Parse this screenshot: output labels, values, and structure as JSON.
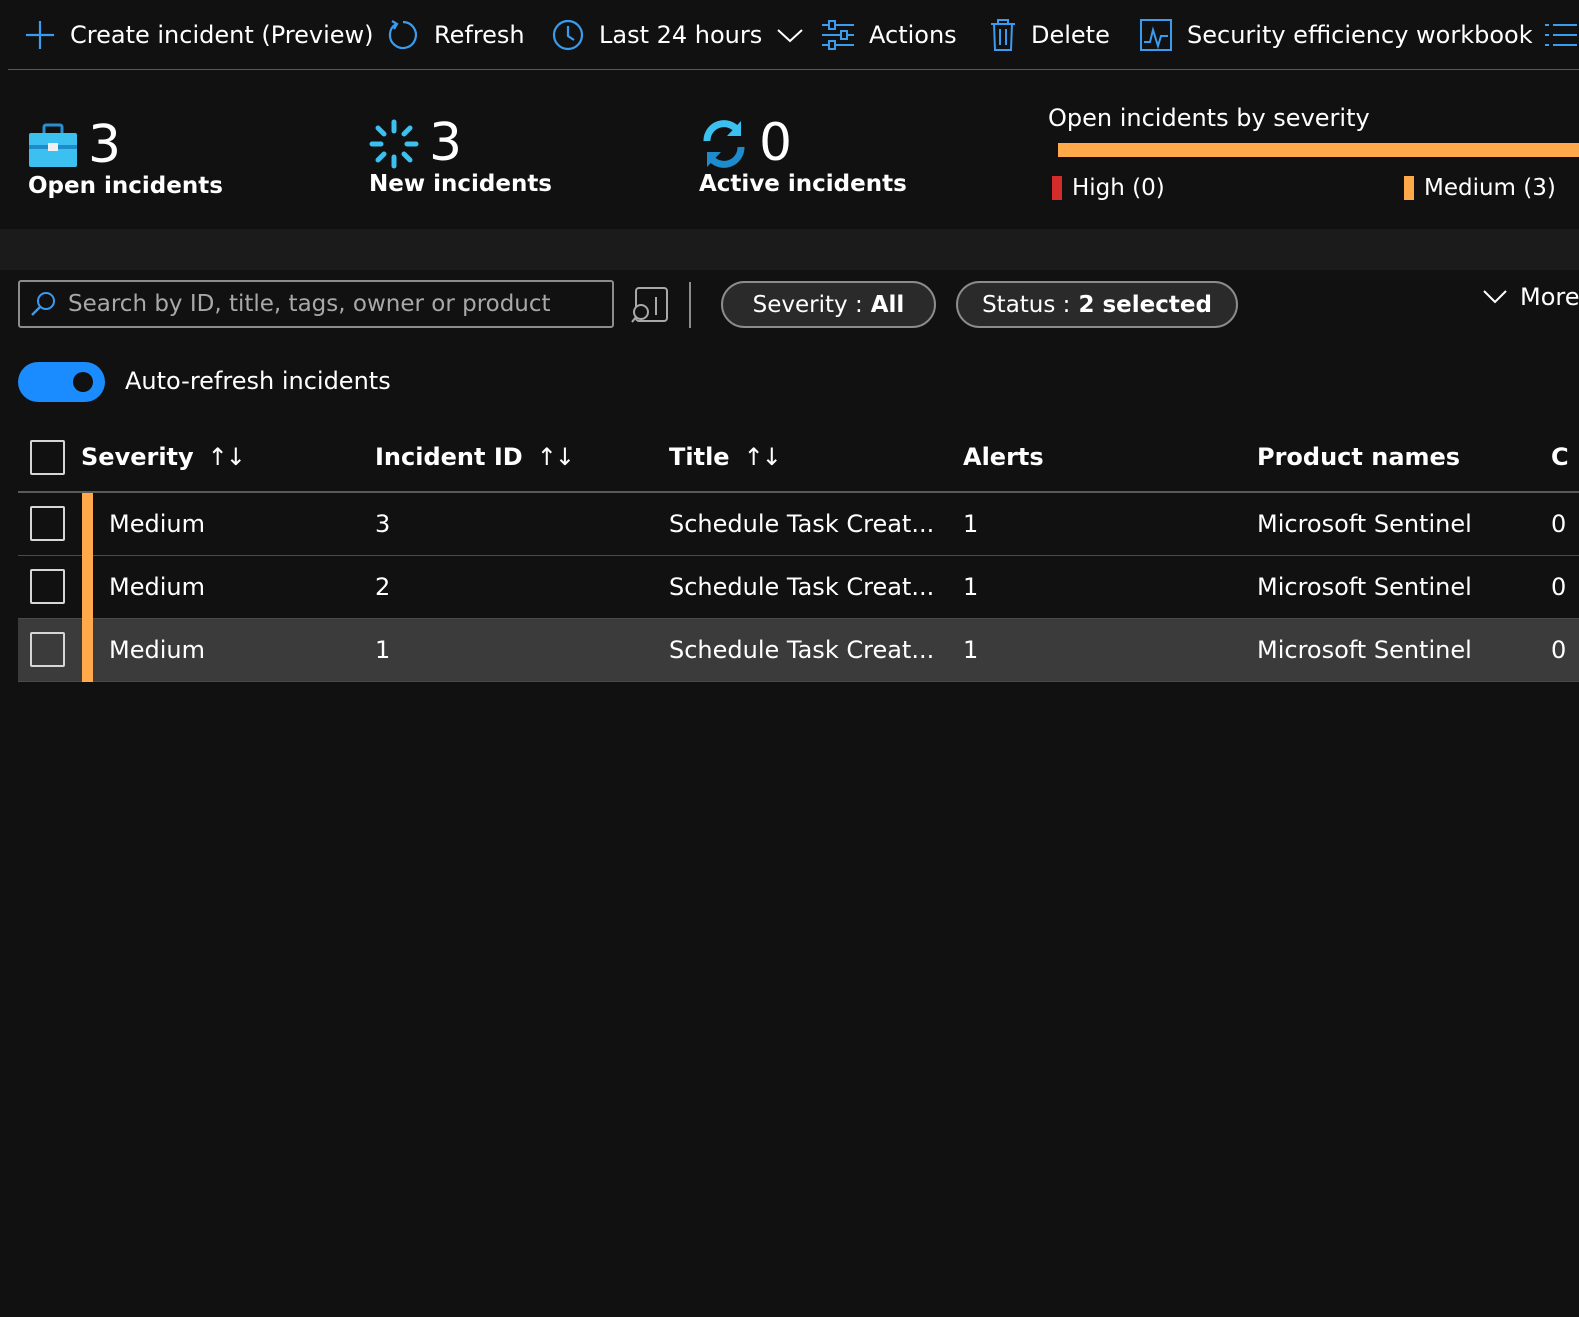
{
  "toolbar": {
    "create_label": "Create incident (Preview)",
    "refresh_label": "Refresh",
    "timerange_label": "Last 24 hours",
    "actions_label": "Actions",
    "delete_label": "Delete",
    "workbook_label": "Security efficiency workbook"
  },
  "summary": {
    "open": {
      "count": "3",
      "label": "Open incidents"
    },
    "new": {
      "count": "3",
      "label": "New incidents"
    },
    "active": {
      "count": "0",
      "label": "Active incidents"
    },
    "severity": {
      "title": "Open incidents by severity",
      "high_label": "High (0)",
      "medium_label": "Medium (3)",
      "high_count": 0,
      "medium_count": 3,
      "colors": {
        "high": "#d42b2b",
        "medium": "#ffa94a"
      }
    }
  },
  "filters": {
    "search_placeholder": "Search by ID, title, tags, owner or product",
    "severity_key": "Severity :",
    "severity_value": "All",
    "status_key": "Status :",
    "status_value": "2 selected",
    "more_label": "More"
  },
  "auto_refresh": {
    "label": "Auto-refresh incidents",
    "on": true
  },
  "table": {
    "columns": [
      "Severity",
      "Incident ID",
      "Title",
      "Alerts",
      "Product names",
      "C"
    ],
    "rows": [
      {
        "severity": "Medium",
        "id": "3",
        "title": "Schedule Task Creat...",
        "alerts": "1",
        "product": "Microsoft Sentinel",
        "next": "0"
      },
      {
        "severity": "Medium",
        "id": "2",
        "title": "Schedule Task Creat...",
        "alerts": "1",
        "product": "Microsoft Sentinel",
        "next": "0"
      },
      {
        "severity": "Medium",
        "id": "1",
        "title": "Schedule Task Creat...",
        "alerts": "1",
        "product": "Microsoft Sentinel",
        "next": "0"
      }
    ]
  },
  "colors": {
    "accent": "#1a8cff",
    "icon_blue": "#3a9bef",
    "background": "#111111"
  }
}
